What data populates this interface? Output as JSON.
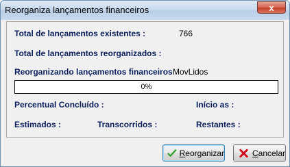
{
  "window": {
    "title": "Reorganiza lançamentos financeiros",
    "close_glyph": "x"
  },
  "fields": {
    "total_existentes_label": "Total de lançamentos existentes :",
    "total_existentes_value": "766",
    "total_reorganizados_label": "Total de lançamentos reorganizados :",
    "reorganizando_label": "Reorganizando lançamentos financeiros",
    "reorganizando_value": "MovLidos",
    "percentual_label": "Percentual Concluído :",
    "inicio_label": "Início as :",
    "estimados_label": "Estimados :",
    "transcorridos_label": "Transcorridos :",
    "restantes_label": "Restantes :"
  },
  "progress": {
    "percent": 0,
    "text": "0%"
  },
  "buttons": {
    "reorganizar": {
      "mnemonic": "R",
      "rest": "eorganizar",
      "icon": "checkmark-icon"
    },
    "cancelar": {
      "mnemonic": "C",
      "rest": "ancelar",
      "icon": "red-x-icon"
    }
  },
  "colors": {
    "label_text": "#0a1f5c",
    "progress_fill": "#0a246a",
    "check_green": "#2e9e2e",
    "cancel_red": "#d0021b"
  }
}
